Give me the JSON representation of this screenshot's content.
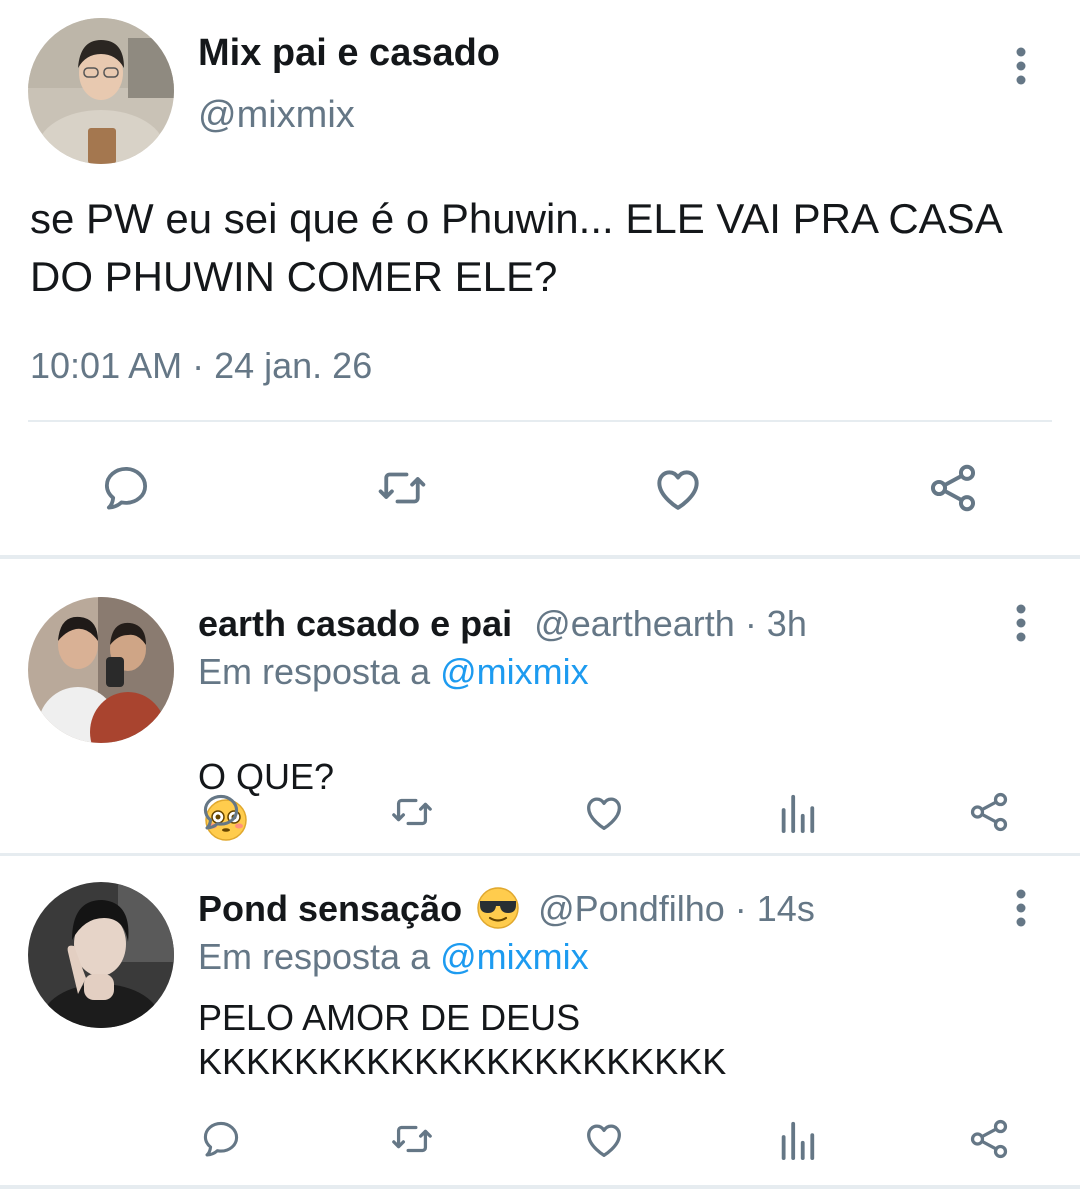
{
  "main_tweet": {
    "display_name": "Mix pai e casado",
    "handle": "@mixmix",
    "text": "se PW eu sei que é o Phuwin... ELE VAI PRA CASA DO PHUWIN COMER ELE?",
    "timestamp": "10:01 AM · 24 jan. 26"
  },
  "replies": [
    {
      "display_name": "earth casado e pai",
      "handle_time": "@earthearth · 3h",
      "in_reply_prefix": "Em resposta a ",
      "in_reply_handle": "@mixmix",
      "text": "O QUE?",
      "emoji": "flushed-face"
    },
    {
      "display_name": "Pond sensação",
      "name_emoji": "sunglasses-face",
      "handle_time": "@Pondfilho · 14s",
      "in_reply_prefix": "Em resposta a ",
      "in_reply_handle": "@mixmix",
      "text": "PELO AMOR DE DEUS\nKKKKKKKKKKKKKKKKKKKKKK"
    }
  ],
  "colors": {
    "text": "#14171a",
    "secondary": "#657786",
    "link": "#1d9bf0",
    "divider": "#e6ecf0"
  },
  "icons": [
    "more-vertical-icon",
    "reply-icon",
    "retweet-icon",
    "like-icon",
    "share-icon",
    "analytics-icon",
    "flushed-face-emoji",
    "sunglasses-emoji"
  ]
}
